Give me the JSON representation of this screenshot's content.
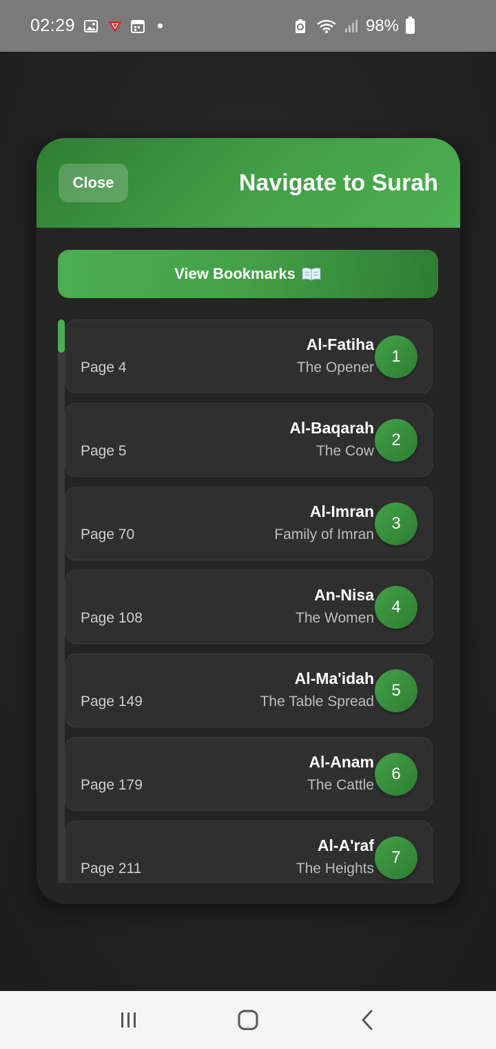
{
  "status_bar": {
    "time": "02:29",
    "battery": "98%",
    "icons": [
      "image-icon",
      "app-shield-icon",
      "calendar-icon",
      "notification-dot-icon",
      "battery-saver-icon",
      "wifi-icon",
      "signal-icon",
      "battery-icon"
    ]
  },
  "modal": {
    "close_label": "Close",
    "title": "Navigate to Surah",
    "bookmarks_label": "View Bookmarks",
    "bookmarks_icon": "open-book-icon",
    "accent_color": "#4caf50"
  },
  "surahs": [
    {
      "number": "1",
      "name": "Al-Fatiha",
      "meaning": "The Opener",
      "page": "Page 4"
    },
    {
      "number": "2",
      "name": "Al-Baqarah",
      "meaning": "The Cow",
      "page": "Page 5"
    },
    {
      "number": "3",
      "name": "Al-Imran",
      "meaning": "Family of Imran",
      "page": "Page 70"
    },
    {
      "number": "4",
      "name": "An-Nisa",
      "meaning": "The Women",
      "page": "Page 108"
    },
    {
      "number": "5",
      "name": "Al-Ma'idah",
      "meaning": "The Table Spread",
      "page": "Page 149"
    },
    {
      "number": "6",
      "name": "Al-Anam",
      "meaning": "The Cattle",
      "page": "Page 179"
    },
    {
      "number": "7",
      "name": "Al-A'raf",
      "meaning": "The Heights",
      "page": "Page 211"
    }
  ],
  "nav_bar": {
    "icons": [
      "recent-apps-icon",
      "home-icon",
      "back-icon"
    ]
  }
}
